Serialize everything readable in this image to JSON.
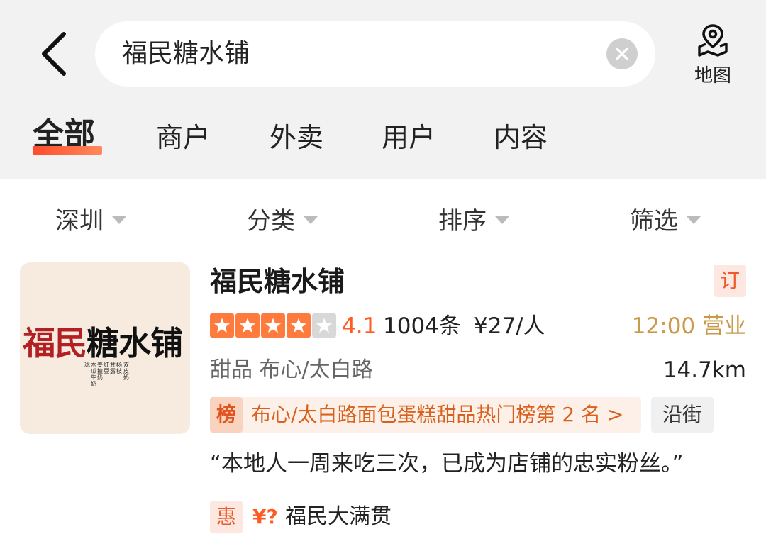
{
  "header": {
    "search_value": "福民糖水铺",
    "map_label": "地图"
  },
  "tabs": [
    {
      "label": "全部",
      "active": true
    },
    {
      "label": "商户"
    },
    {
      "label": "外卖"
    },
    {
      "label": "用户"
    },
    {
      "label": "内容"
    }
  ],
  "filters": [
    "深圳",
    "分类",
    "排序",
    "筛选"
  ],
  "shop": {
    "thumb": {
      "logo_red": "福民",
      "logo_dark": "糖水铺",
      "logo_small": [
        "双皮奶",
        "杨枝",
        "甘露",
        "红豆",
        "姜撞奶",
        "木瓜牛奶",
        "冰"
      ]
    },
    "name": "福民糖水铺",
    "booking_badge": "订",
    "rating_stars": 4,
    "score": "4.1",
    "reviews": "1004条",
    "price": "¥27/人",
    "hours": "12:00 营业",
    "category": "甜品  布心/太白路",
    "distance": "14.7km",
    "rank_icon": "榜",
    "rank_text": "布心/太白路面包蛋糕甜品热门榜第 2 名 >",
    "street_badge": "沿街",
    "quote": "“本地人一周来吃三次，已成为店铺的忠实粉丝。”",
    "deal_icon": "惠",
    "deal_price": "¥?",
    "deal_name": "福民大满贯"
  },
  "colors": {
    "accent": "#ff5b24",
    "hours": "#c99a4b",
    "logo_red": "#b32024"
  }
}
